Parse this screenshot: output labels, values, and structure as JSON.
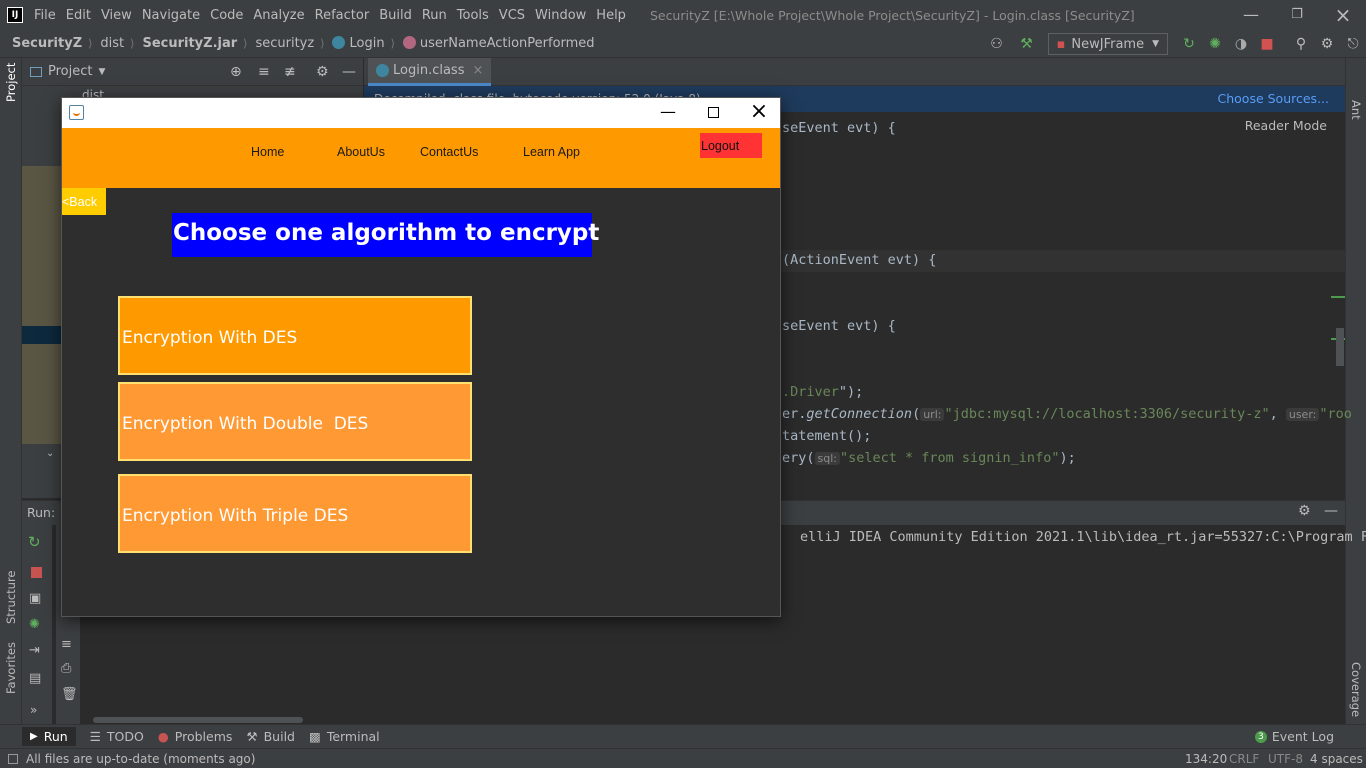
{
  "menubar": {
    "logo": "IJ",
    "items": [
      "File",
      "Edit",
      "View",
      "Navigate",
      "Code",
      "Analyze",
      "Refactor",
      "Build",
      "Run",
      "Tools",
      "VCS",
      "Window",
      "Help"
    ],
    "window_title": "SecurityZ [E:\\Whole Project\\Whole Project\\SecurityZ] - Login.class [SecurityZ]"
  },
  "navbar": {
    "crumbs": [
      "SecurityZ",
      "dist",
      "SecurityZ.jar",
      "securityz",
      "Login",
      "userNameActionPerformed"
    ],
    "run_config": "NewJFrame"
  },
  "left_strip": {
    "project": "Project",
    "structure": "Structure",
    "favorites": "Favorites"
  },
  "right_strip": {
    "ant": "Ant",
    "coverage": "Coverage"
  },
  "project_panel": {
    "title": "Project",
    "tree_item": "dist"
  },
  "editor": {
    "tab": "Login.class",
    "info_link": "Choose Sources...",
    "info_text": "Decompiled .class file, bytecode version: 52.0 (Java 8)",
    "reader_mode": "Reader Mode",
    "lines": {
      "l1": "seEvent evt) {",
      "l2": "(ActionEvent evt) {",
      "l3": "seEvent evt) {",
      "l4_pre": ".Driver",
      "l4_post": "\");",
      "l5_pre": "er.",
      "l5_method": "getConnection",
      "l5_hint1": "url:",
      "l5_str": "\"jdbc:mysql://localhost:3306/security-z\"",
      "l5_hint2": "user:",
      "l5_str2": "\"roo",
      "l6": "tatement();",
      "l7_pre": "ery(",
      "l7_hint": "sql:",
      "l7_str": "\"select * from signin_info\"",
      "l7_post": ");"
    }
  },
  "run_panel": {
    "label": "Run:",
    "output": "elliJ IDEA Community Edition 2021.1\\lib\\idea_rt.jar=55327:C:\\Program Fi"
  },
  "bottom_tools": [
    "Run",
    "TODO",
    "Problems",
    "Build",
    "Terminal"
  ],
  "event_log": {
    "count": "3",
    "label": "Event Log"
  },
  "status": {
    "message": "All files are up-to-date (moments ago)",
    "position": "134:20",
    "line_sep": "CRLF",
    "encoding": "UTF-8",
    "indent": "4 spaces"
  },
  "app": {
    "nav": [
      "Home",
      "AboutUs",
      "ContactUs",
      "Learn App"
    ],
    "logout": "Logout",
    "back": "<Back",
    "heading": "Choose one algorithm to encrypt",
    "buttons": [
      "Encryption With DES",
      "Encryption With Double  DES",
      "Encryption With Triple DES"
    ],
    "colors": {
      "nav_bg": "#ff9900",
      "heading_bg": "#0000ff",
      "logout_bg": "#ff3333",
      "back_bg": "#ffcc00",
      "btn1": "#ff9900",
      "btn2": "#ff9933"
    }
  }
}
